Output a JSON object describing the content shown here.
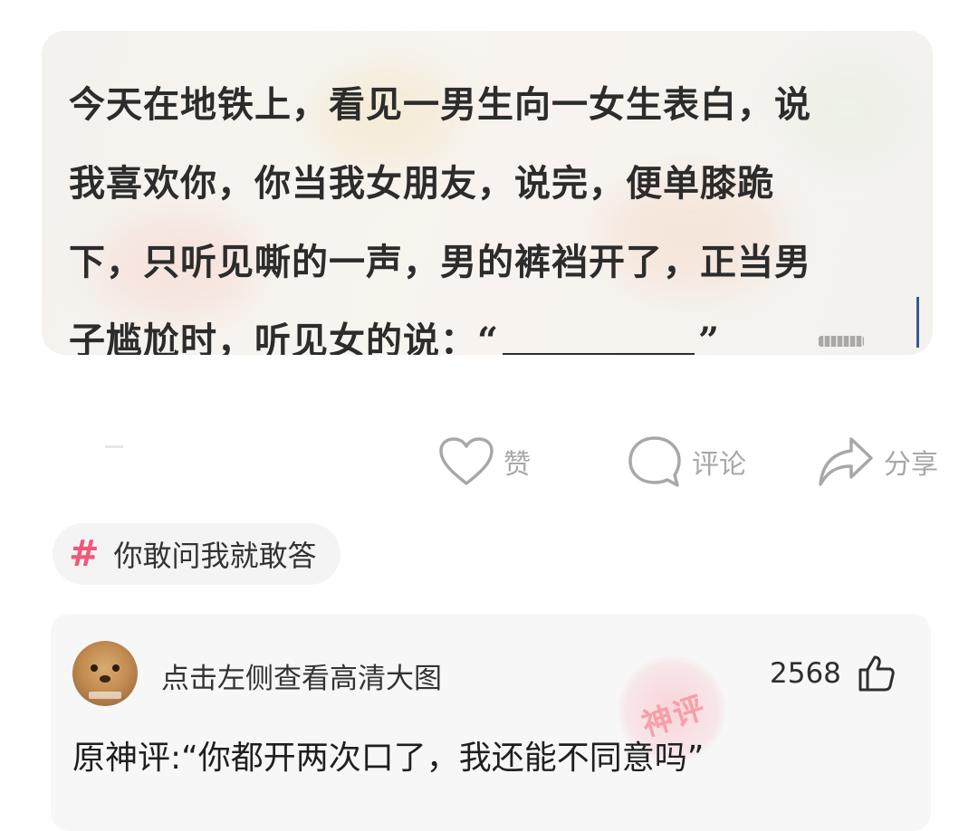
{
  "post": {
    "image_text": {
      "line1": "今天在地铁上，看见一男生向一女生表白，说",
      "line2": "我喜欢你，你当我女朋友，说完，便单膝跪",
      "line3": "下，只听见嘶的一声，男的裤裆开了，正当男",
      "line4_prefix": "子尴尬时，听见女的说：“",
      "line4_suffix": "”"
    }
  },
  "actions": {
    "like_label": "赞",
    "comment_label": "评论",
    "share_label": "分享"
  },
  "topic": {
    "hash": "#",
    "label": "你敢问我就敢答"
  },
  "top_comment": {
    "user_name": "点击左侧查看高清大图",
    "like_count": "2568",
    "stamp_text": "神评",
    "text": "原神评:“你都开两次口了，我还能不同意吗”"
  },
  "colors": {
    "accent_pink": "#f0577a",
    "icon_gray": "#a8a8a8"
  },
  "icons": [
    "heart-icon",
    "comment-bubble-icon",
    "share-arrow-icon",
    "thumbs-up-icon",
    "hashtag-icon"
  ]
}
